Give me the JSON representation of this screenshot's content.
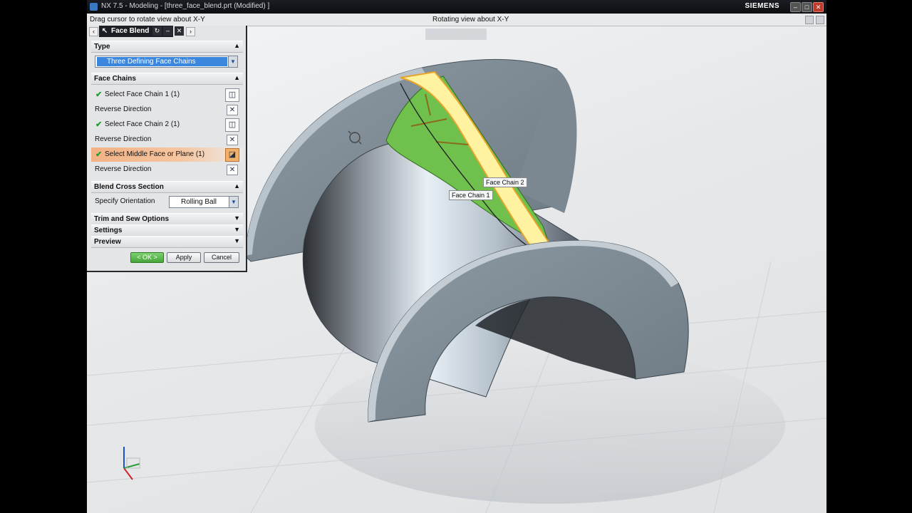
{
  "window": {
    "title": "NX 7.5 - Modeling - [three_face_blend.prt (Modified) ]",
    "brand": "SIEMENS"
  },
  "cue": {
    "prompt": "Drag cursor to rotate view about X-Y",
    "status": "Rotating view about X-Y"
  },
  "dialog": {
    "title": "Face Blend",
    "type_group": "Type",
    "type_value": "Three Defining Face Chains",
    "face_chains_group": "Face Chains",
    "rows": [
      {
        "label": "Select Face Chain 1 (1)",
        "checked": true
      },
      {
        "label": "Reverse Direction",
        "checked": false
      },
      {
        "label": "Select Face Chain 2 (1)",
        "checked": true
      },
      {
        "label": "Reverse Direction",
        "checked": false
      },
      {
        "label": "Select Middle Face or Plane (1)",
        "checked": true
      },
      {
        "label": "Reverse Direction",
        "checked": false
      }
    ],
    "cross_section_group": "Blend Cross Section",
    "orientation_label": "Specify Orientation",
    "orientation_value": "Rolling Ball",
    "trim_group": "Trim and Sew Options",
    "settings_group": "Settings",
    "preview_group": "Preview",
    "ok": "< OK >",
    "apply": "Apply",
    "cancel": "Cancel"
  },
  "annotations": {
    "face_chain_1": "Face Chain 1",
    "face_chain_2": "Face Chain 2"
  },
  "colors": {
    "title_bg": "#0c0e11",
    "ok_green": "#46a43a",
    "highlight_orange": "#f2b185",
    "selection_green": "#6fc04d",
    "selection_yellow": "#fff2a0"
  }
}
